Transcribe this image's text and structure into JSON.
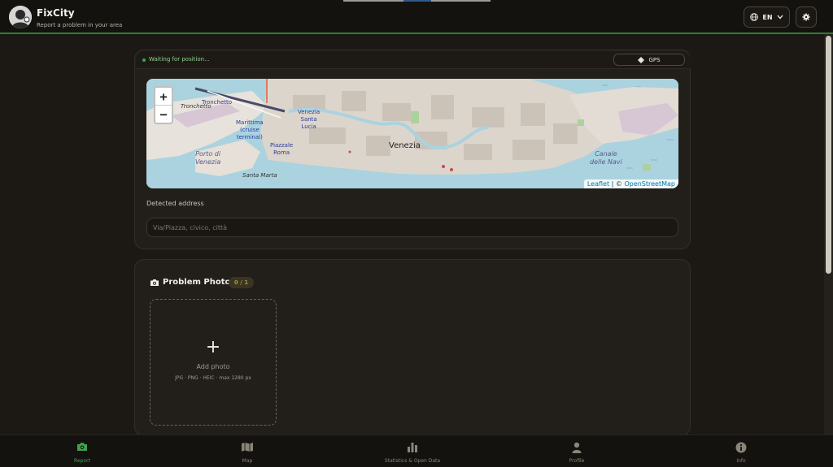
{
  "header": {
    "app_title": "FixCity",
    "app_subtitle": "Report a problem in your area",
    "language": "EN",
    "logo_icon": "user-avatar-icon",
    "settings_icon": "gear-icon",
    "accent_color": "#2f7d32"
  },
  "location": {
    "status_text": "Waiting for position...",
    "gps_label": "GPS",
    "map": {
      "zoom_in": "+",
      "zoom_out": "−",
      "attribution_leaflet": "Leaflet",
      "attribution_sep": " | © ",
      "attribution_osm": "OpenStreetMap",
      "labels": {
        "city": "Venezia",
        "tronchetto_island": "Tronchetto",
        "tronchetto": "Tronchetto",
        "marittima_1": "Marittima",
        "marittima_2": "(cruise",
        "marittima_3": "terminal)",
        "santa_lucia_1": "Venezia",
        "santa_lucia_2": "Santa",
        "santa_lucia_3": "Lucia",
        "piazzale_1": "Piazzale",
        "piazzale_2": "Roma",
        "porto_1": "Porto di",
        "porto_2": "Venezia",
        "santa_marta": "Santa Marta",
        "canale_1": "Canale",
        "canale_2": "delle Navi"
      }
    },
    "address_label": "Detected address",
    "address_placeholder": "Via/Piazza, civico, città",
    "address_value": ""
  },
  "photo": {
    "title": "Problem Photo",
    "count": "0 / 1",
    "add_label": "Add photo",
    "hint": "JPG · PNG · HEIC · max 1280 px",
    "plus": "+",
    "icon": "camera-icon"
  },
  "nav": {
    "items": [
      {
        "label": "Report",
        "icon": "camera-icon",
        "active": true
      },
      {
        "label": "Map",
        "icon": "map-icon",
        "active": false
      },
      {
        "label": "Statistics & Open Data",
        "icon": "bar-chart-icon",
        "active": false
      },
      {
        "label": "Profile",
        "icon": "person-icon",
        "active": false
      },
      {
        "label": "Info",
        "icon": "info-icon",
        "active": false
      }
    ],
    "active_color": "#3fa34d",
    "inactive_color": "#8a8479"
  }
}
